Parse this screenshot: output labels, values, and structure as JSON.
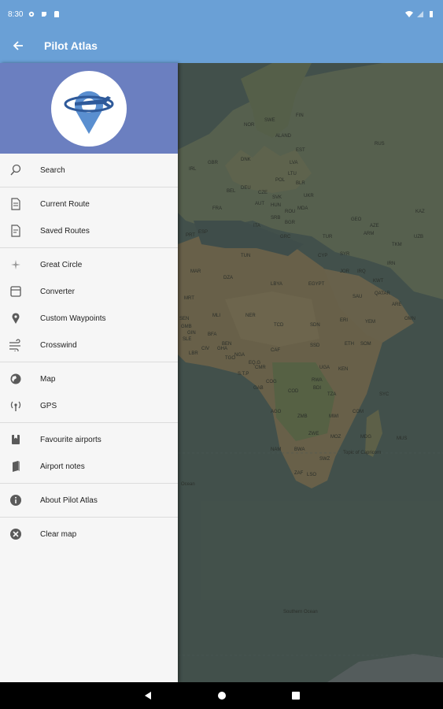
{
  "status_bar": {
    "time": "8:30"
  },
  "app_bar": {
    "title": "Pilot Atlas"
  },
  "menu": {
    "groups": [
      [
        {
          "label": "Search",
          "icon": "search-icon"
        }
      ],
      [
        {
          "label": "Current Route",
          "icon": "route-doc-icon"
        },
        {
          "label": "Saved Routes",
          "icon": "saved-doc-icon"
        }
      ],
      [
        {
          "label": "Great Circle",
          "icon": "great-circle-icon"
        },
        {
          "label": "Converter",
          "icon": "converter-icon"
        },
        {
          "label": "Custom Waypoints",
          "icon": "pin-icon"
        },
        {
          "label": "Crosswind",
          "icon": "wind-icon"
        }
      ],
      [
        {
          "label": "Map",
          "icon": "globe-icon"
        },
        {
          "label": "GPS",
          "icon": "gps-icon"
        }
      ],
      [
        {
          "label": "Favourite airports",
          "icon": "favourite-icon"
        },
        {
          "label": "Airport notes",
          "icon": "notes-icon"
        }
      ],
      [
        {
          "label": "About Pilot Atlas",
          "icon": "info-icon"
        }
      ],
      [
        {
          "label": "Clear map",
          "icon": "clear-icon"
        }
      ]
    ]
  },
  "map": {
    "labels": [
      "ALAND",
      "EST",
      "LVA",
      "LTU",
      "POL",
      "BLR",
      "UKR",
      "MDA",
      "ROU",
      "BGR",
      "SRB",
      "GRC",
      "ITA",
      "AUT",
      "CZE",
      "SVK",
      "HUN",
      "DEU",
      "BEL",
      "FRA",
      "ESP",
      "PRT",
      "GBR",
      "IRL",
      "DNK",
      "NOR",
      "SWE",
      "FIN",
      "RUS",
      "KAZ",
      "UZB",
      "TKM",
      "AZE",
      "GEO",
      "ARM",
      "TUR",
      "CYP",
      "SYR",
      "IRQ",
      "IRN",
      "JOR",
      "SAU",
      "KWT",
      "QATAR",
      "ARE",
      "OMN",
      "YEM",
      "EGYPT",
      "LBYA",
      "TUN",
      "DZA",
      "MAR",
      "MRT",
      "MLI",
      "NER",
      "TCD",
      "SDN",
      "ERI",
      "ETH",
      "SOM",
      "KEN",
      "UGA",
      "TZA",
      "RWA",
      "BDI",
      "COD",
      "COG",
      "GAB",
      "CMR",
      "NGA",
      "BEN",
      "GHA",
      "CIV",
      "LBR",
      "GIN",
      "SEN",
      "GMB",
      "SLE",
      "BFA",
      "TGO",
      "CAF",
      "SSD",
      "AGO",
      "ZMB",
      "MWI",
      "MOZ",
      "ZWE",
      "BWA",
      "NAM",
      "ZAF",
      "LSO",
      "SWZ",
      "MDG",
      "COM",
      "SYC",
      "MUS",
      "S.T.P",
      "EQ.G",
      "Topic of Capricorn",
      "Ocean",
      "Southern Ocean"
    ]
  },
  "colors": {
    "app_bar": "#6aa0d6",
    "drawer_header": "#6b7fc0",
    "logo_pin": "#5a8fd0",
    "icon": "#5a5a5a"
  }
}
